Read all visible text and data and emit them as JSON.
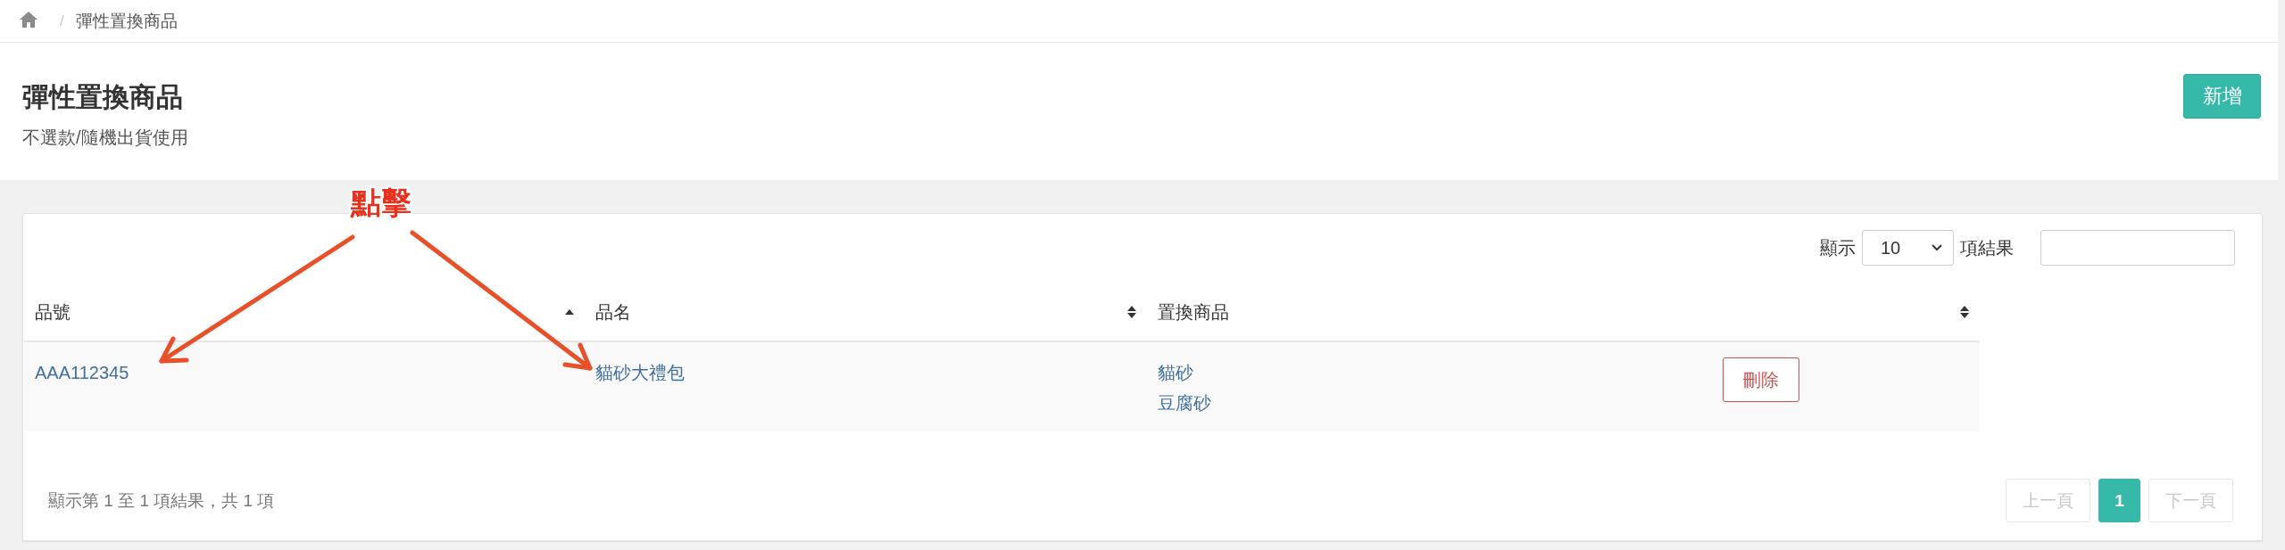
{
  "breadcrumb": {
    "separator": "/",
    "items": [
      {
        "label": "彈性置換商品"
      }
    ]
  },
  "header": {
    "title": "彈性置換商品",
    "subtitle": "不選款/隨機出貨使用",
    "add_button": "新增"
  },
  "annotation": {
    "label": "點擊"
  },
  "length_menu": {
    "prefix": "顯示",
    "value": "10",
    "suffix": "項結果"
  },
  "table": {
    "columns": [
      {
        "label": "品號",
        "sort_up": true,
        "sort_down": false
      },
      {
        "label": "品名",
        "sort_up": true,
        "sort_down": true
      },
      {
        "label": "置換商品",
        "sort_up": true,
        "sort_down": true
      }
    ],
    "rows": [
      {
        "code": "AAA112345",
        "name": "貓砂大禮包",
        "replacements": [
          "貓砂",
          "豆腐砂"
        ],
        "action": "刪除"
      }
    ]
  },
  "footer": {
    "info": "顯示第 1 至 1 項結果，共 1 項",
    "pages": [
      {
        "label": "上一頁",
        "selected": false,
        "disabled": true
      },
      {
        "label": "1",
        "selected": true,
        "disabled": false
      },
      {
        "label": "下一頁",
        "selected": false,
        "disabled": true
      }
    ]
  }
}
